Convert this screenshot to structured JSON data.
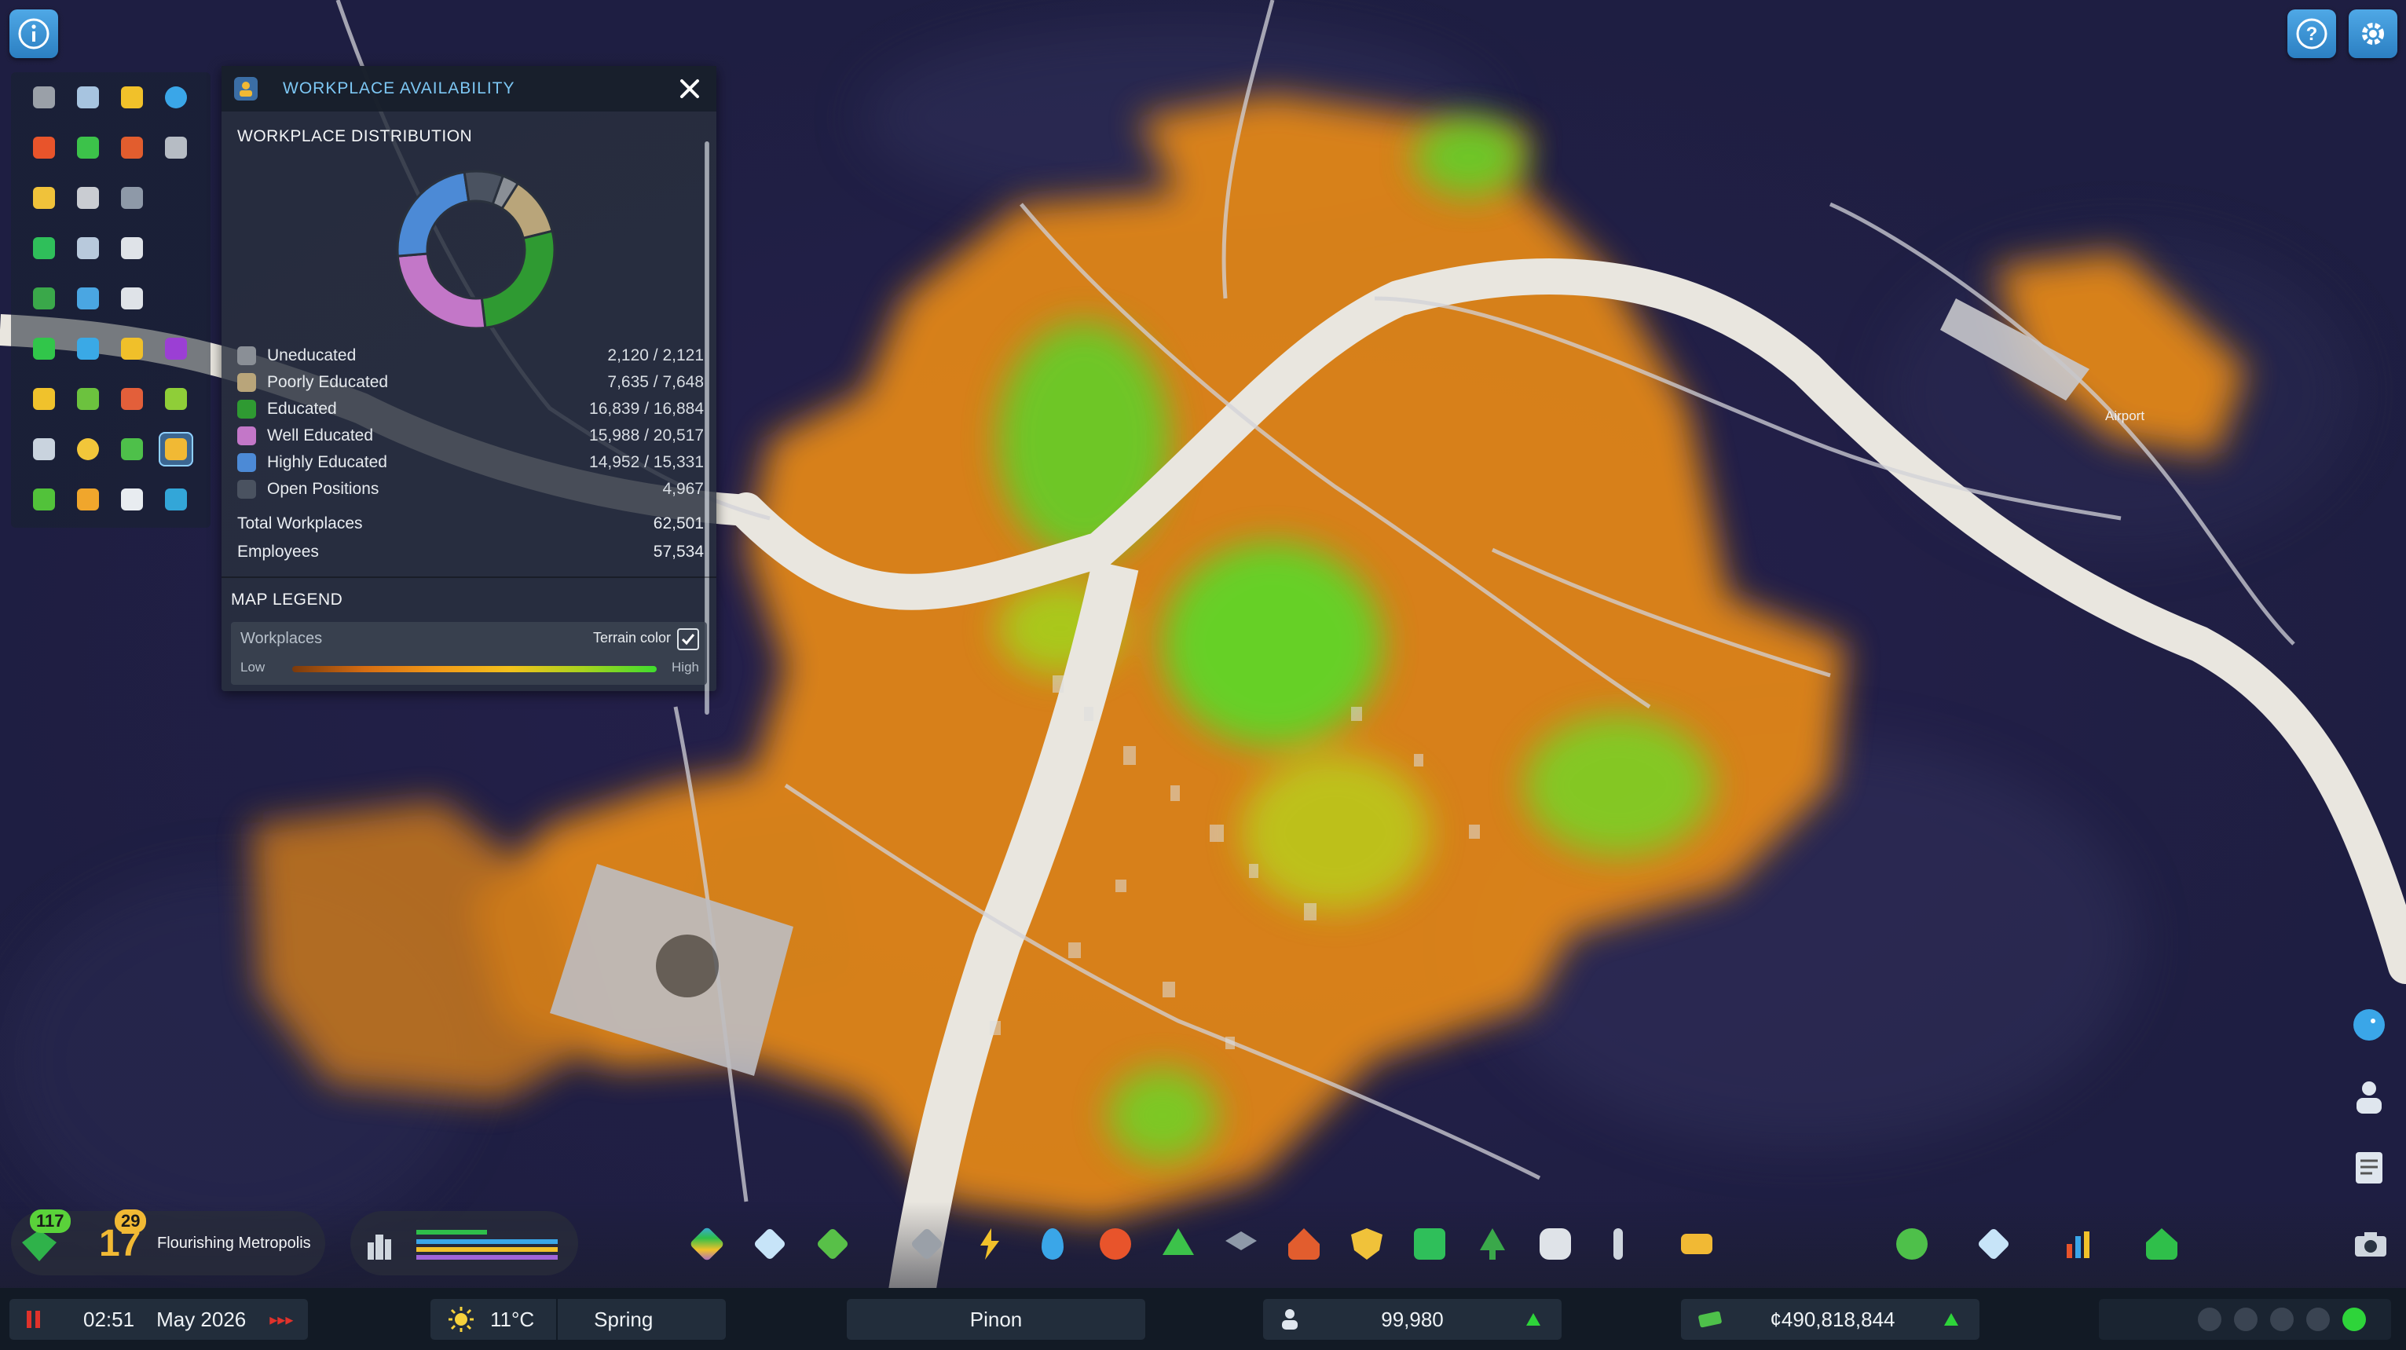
{
  "panel": {
    "title": "WORKPLACE AVAILABILITY",
    "distribution_title": "WORKPLACE DISTRIBUTION",
    "rows": [
      {
        "label": "Uneducated",
        "value": "2,120 / 2,121",
        "color": "#8a8f96"
      },
      {
        "label": "Poorly Educated",
        "value": "7,635 / 7,648",
        "color": "#b9a57a"
      },
      {
        "label": "Educated",
        "value": "16,839 / 16,884",
        "color": "#2f9a32"
      },
      {
        "label": "Well Educated",
        "value": "15,988 / 20,517",
        "color": "#c377c8"
      },
      {
        "label": "Highly Educated",
        "value": "14,952 / 15,331",
        "color": "#4c8ad6"
      },
      {
        "label": "Open Positions",
        "value": "4,967",
        "color": "#4a5260"
      }
    ],
    "totals": [
      {
        "label": "Total Workplaces",
        "value": "62,501"
      },
      {
        "label": "Employees",
        "value": "57,534"
      }
    ],
    "legend_title": "MAP LEGEND",
    "legend": {
      "name": "Workplaces",
      "terrain_label": "Terrain color",
      "terrain_checked": true,
      "low": "Low",
      "high": "High"
    }
  },
  "chart_data": {
    "type": "pie",
    "title": "",
    "categories": [
      "Uneducated",
      "Poorly Educated",
      "Educated",
      "Well Educated",
      "Highly Educated",
      "Open Positions"
    ],
    "values": [
      2120,
      7635,
      16839,
      15988,
      14952,
      4967
    ],
    "colors": [
      "#8a8f96",
      "#b9a57a",
      "#2f9a32",
      "#c377c8",
      "#4c8ad6",
      "#4a5260"
    ]
  },
  "map": {
    "airport_label": "Airport"
  },
  "toolbar": {
    "level_badge": "117",
    "milestone_number": "17",
    "milestone_badge": "29",
    "milestone_title": "Flourishing Metropolis"
  },
  "status": {
    "time": "02:51",
    "date": "May 2026",
    "speed": "▸▸▸",
    "temperature": "11°C",
    "season": "Spring",
    "city_name": "Pinon",
    "population": "99,980",
    "money": "¢490,818,844"
  },
  "colors": {
    "accent": "#4fa8e6",
    "title_blue": "#7dc7f4",
    "status_green": "#2ed43a",
    "pause_red": "#e0322b"
  },
  "icons": {
    "top_left": "info-icon",
    "top_right": [
      "help-icon",
      "settings-icon"
    ],
    "right_side": [
      "chirper-bird-icon",
      "citizen-icon",
      "notes-icon",
      "camera-icon"
    ]
  }
}
